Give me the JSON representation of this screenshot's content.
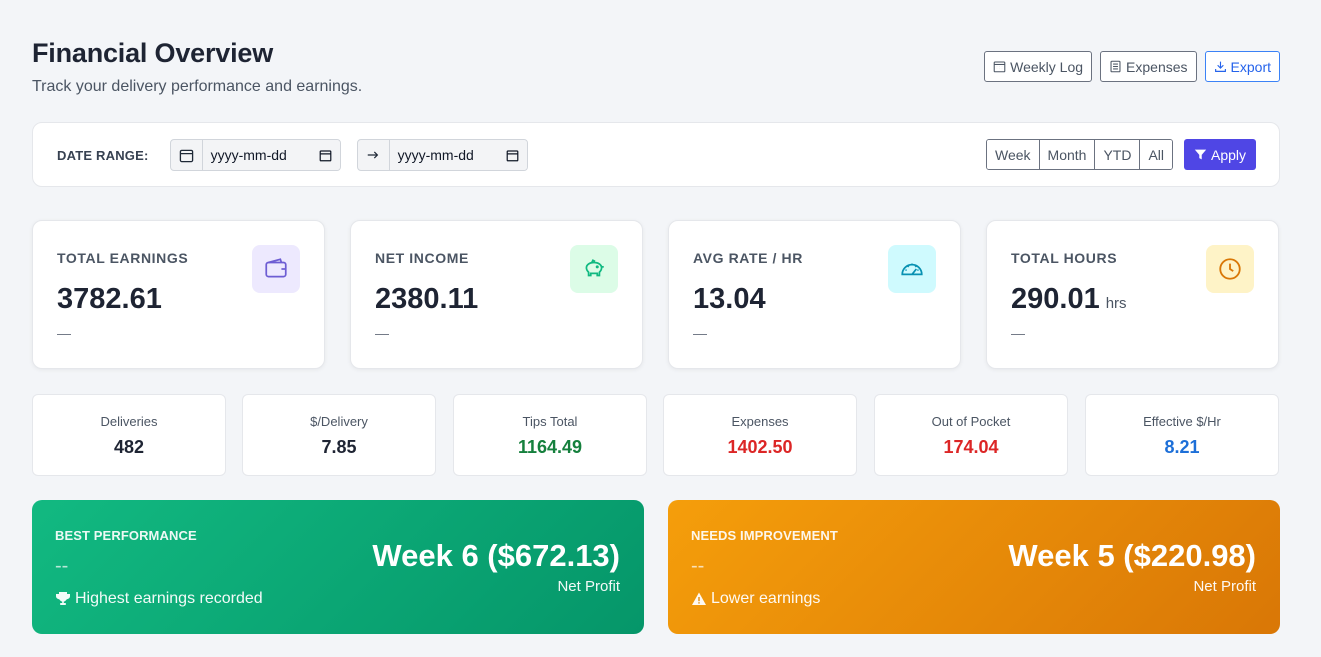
{
  "header": {
    "title": "Financial Overview",
    "subtitle": "Track your delivery performance and earnings.",
    "actions": {
      "weekly_log": "Weekly Log",
      "expenses": "Expenses",
      "export": "Export"
    }
  },
  "filter": {
    "label": "DATE RANGE:",
    "start_placeholder": "yyyy-mm-dd",
    "end_placeholder": "yyyy-mm-dd",
    "presets": [
      "Week",
      "Month",
      "YTD",
      "All"
    ],
    "apply_label": "Apply"
  },
  "kpis": [
    {
      "label": "TOTAL EARNINGS",
      "value": "3782.61",
      "unit": "",
      "change": "—",
      "icon": "wallet-icon",
      "icon_color": "#6d5dd3",
      "icon_bg": "#ede9fe"
    },
    {
      "label": "NET INCOME",
      "value": "2380.11",
      "unit": "",
      "change": "—",
      "icon": "piggy-bank-icon",
      "icon_color": "#10b981",
      "icon_bg": "#dcfce7"
    },
    {
      "label": "AVG RATE / HR",
      "value": "13.04",
      "unit": "",
      "change": "—",
      "icon": "speedometer-icon",
      "icon_color": "#0891b2",
      "icon_bg": "#cffafe"
    },
    {
      "label": "TOTAL HOURS",
      "value": "290.01",
      "unit": "hrs",
      "change": "—",
      "icon": "clock-icon",
      "icon_color": "#d97706",
      "icon_bg": "#fef3c7"
    }
  ],
  "mini_stats": [
    {
      "label": "Deliveries",
      "value": "482",
      "color": "#1e2433"
    },
    {
      "label": "$/Delivery",
      "value": "7.85",
      "color": "#1e2433"
    },
    {
      "label": "Tips Total",
      "value": "1164.49",
      "color": "#15803d"
    },
    {
      "label": "Expenses",
      "value": "1402.50",
      "color": "#dc2626"
    },
    {
      "label": "Out of Pocket",
      "value": "174.04",
      "color": "#dc2626"
    },
    {
      "label": "Effective $/Hr",
      "value": "8.21",
      "color": "#1d6fd8"
    }
  ],
  "best": {
    "label": "BEST PERFORMANCE",
    "dash": "--",
    "note": "Highest earnings recorded",
    "week": "Week 6 ($672.13)",
    "sub": "Net Profit"
  },
  "worst": {
    "label": "NEEDS IMPROVEMENT",
    "dash": "--",
    "note": "Lower earnings",
    "week": "Week 5 ($220.98)",
    "sub": "Net Profit"
  },
  "colors": {
    "accent": "#4f46e5",
    "success": "#10b981",
    "warning": "#f59e0b"
  }
}
